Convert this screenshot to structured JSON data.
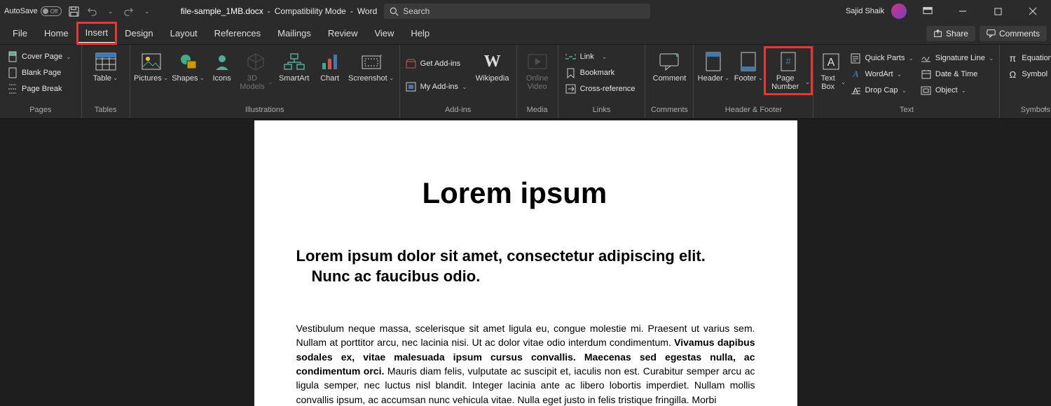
{
  "title_bar": {
    "autosave_label": "AutoSave",
    "autosave_state": "Off",
    "filename": "file-sample_1MB.docx",
    "mode": "Compatibility Mode",
    "app": "Word",
    "search_placeholder": "Search",
    "user_name": "Sajid Shaik"
  },
  "tabs": {
    "file": "File",
    "home": "Home",
    "insert": "Insert",
    "design": "Design",
    "layout": "Layout",
    "references": "References",
    "mailings": "Mailings",
    "review": "Review",
    "view": "View",
    "help": "Help",
    "share": "Share",
    "comments": "Comments"
  },
  "ribbon": {
    "pages": {
      "label": "Pages",
      "cover_page": "Cover Page",
      "blank_page": "Blank Page",
      "page_break": "Page Break"
    },
    "tables": {
      "label": "Tables",
      "table": "Table"
    },
    "illustrations": {
      "label": "Illustrations",
      "pictures": "Pictures",
      "shapes": "Shapes",
      "icons": "Icons",
      "models": "3D Models",
      "smartart": "SmartArt",
      "chart": "Chart",
      "screenshot": "Screenshot"
    },
    "addins": {
      "label": "Add-ins",
      "get": "Get Add-ins",
      "my": "My Add-ins",
      "wikipedia": "Wikipedia"
    },
    "media": {
      "label": "Media",
      "online_video": "Online Video"
    },
    "links": {
      "label": "Links",
      "link": "Link",
      "bookmark": "Bookmark",
      "cross_ref": "Cross-reference"
    },
    "comments": {
      "label": "Comments",
      "comment": "Comment"
    },
    "header_footer": {
      "label": "Header & Footer",
      "header": "Header",
      "footer": "Footer",
      "page_number": "Page Number"
    },
    "text": {
      "label": "Text",
      "text_box": "Text Box",
      "quick_parts": "Quick Parts",
      "wordart": "WordArt",
      "drop_cap": "Drop Cap",
      "sig_line": "Signature Line",
      "date_time": "Date & Time",
      "object": "Object"
    },
    "symbols": {
      "label": "Symbols",
      "equation": "Equation",
      "symbol": "Symbol"
    }
  },
  "document": {
    "title": "Lorem ipsum",
    "subtitle_line1": "Lorem ipsum dolor sit amet, consectetur adipiscing elit.",
    "subtitle_line2": "Nunc ac faucibus odio.",
    "body": "Vestibulum neque massa, scelerisque sit amet ligula eu, congue molestie mi. Praesent ut varius sem. Nullam at porttitor arcu, nec lacinia nisi. Ut ac dolor vitae odio interdum condimentum. Vivamus dapibus sodales ex, vitae malesuada ipsum cursus convallis. Maecenas sed egestas nulla, ac condimentum orci. Mauris diam felis, vulputate ac suscipit et, iaculis non est. Curabitur semper arcu ac ligula semper, nec luctus nisl blandit. Integer lacinia ante ac libero lobortis imperdiet. Nullam mollis convallis ipsum, ac accumsan nunc vehicula vitae. Nulla eget justo in felis tristique fringilla. Morbi"
  }
}
